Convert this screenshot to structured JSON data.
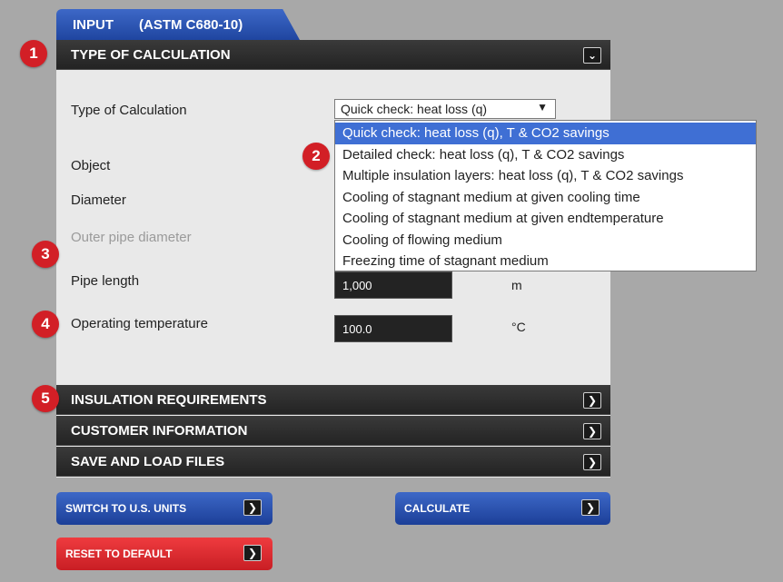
{
  "header": {
    "tab_label": "INPUT",
    "tab_standard": "(ASTM C680-10)"
  },
  "sections": {
    "type_of_calculation": "TYPE OF CALCULATION",
    "insulation_requirements": "INSULATION REQUIREMENTS",
    "customer_information": "CUSTOMER INFORMATION",
    "save_and_load_files": "SAVE AND LOAD FILES"
  },
  "form": {
    "type_label": "Type of Calculation",
    "type_selected": "Quick check: heat loss (q)",
    "object_label": "Object",
    "diameter_label": "Diameter",
    "outer_pipe_diameter_label": "Outer pipe diameter",
    "pipe_length_label": "Pipe length",
    "pipe_length_value": "1,000",
    "pipe_length_unit": "m",
    "operating_temperature_label": "Operating temperature",
    "operating_temperature_value": "100.0",
    "operating_temperature_unit": "°C"
  },
  "dropdown_options": [
    "Quick check: heat loss (q), T & CO2 savings",
    "Detailed check: heat loss (q), T & CO2 savings",
    "Multiple insulation layers: heat loss (q), T & CO2 savings",
    "Cooling of stagnant medium at given cooling time",
    "Cooling of stagnant medium at given endtemperature",
    "Cooling of flowing medium",
    "Freezing time of stagnant medium"
  ],
  "buttons": {
    "switch_units": "SWITCH TO U.S. UNITS",
    "calculate": "CALCULATE",
    "reset": "RESET TO DEFAULT"
  },
  "markers": [
    "1",
    "2",
    "3",
    "4",
    "5"
  ],
  "icons": {
    "collapse": "chevron-down-icon",
    "expand": "chevron-right-icon",
    "select_caret": "caret-down-icon"
  },
  "colors": {
    "accent_blue": "#2b55b8",
    "accent_red": "#d21f26",
    "dark_bar": "#2a2a2a",
    "panel_bg": "#e9e9e9",
    "selected_option": "#3f6fd4"
  }
}
